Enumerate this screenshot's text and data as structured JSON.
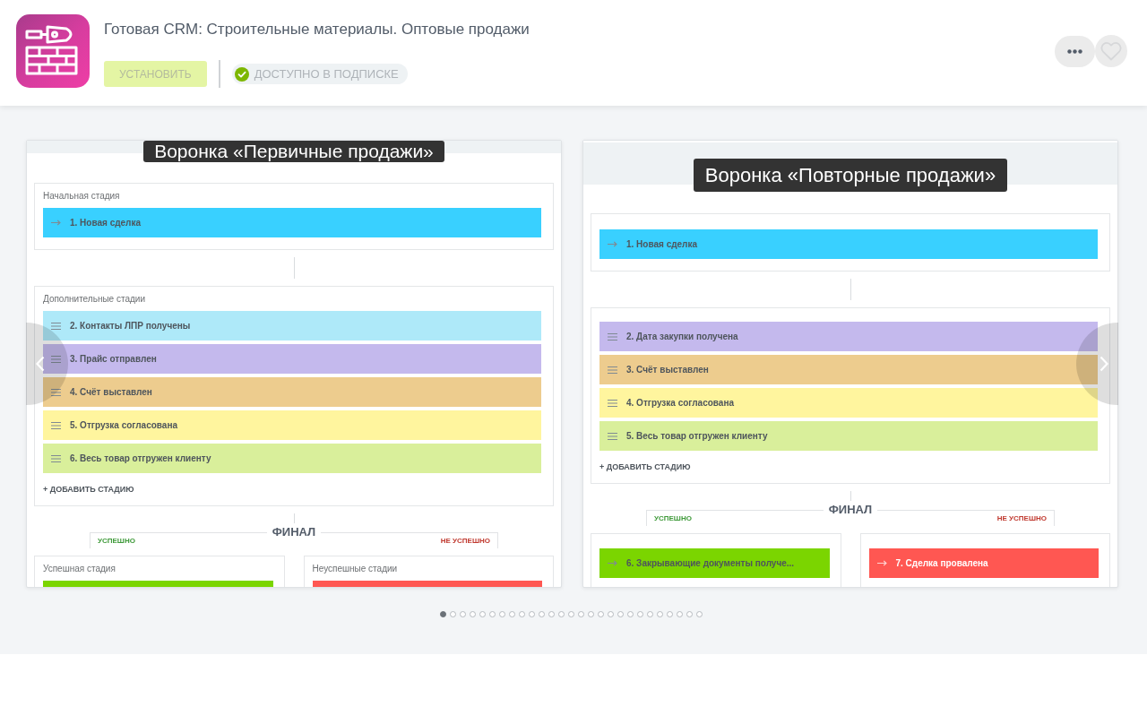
{
  "header": {
    "title": "Готовая CRM: Строительные материалы. Оптовые продажи",
    "install_button": {
      "label": "УСТАНОВИТЬ",
      "disabled": true
    },
    "subscription_badge": "ДОСТУПНО В ПОДПИСКЕ"
  },
  "slides": [
    {
      "title": "Воронка «Первичные продажи»",
      "start": {
        "label": "Начальная стадия",
        "stages": [
          {
            "kind": "fixed",
            "name": "1. Новая сделка",
            "color": "#39d0ff"
          }
        ]
      },
      "extra": {
        "label": "Дополнительные стадии",
        "stages": [
          {
            "kind": "sortable",
            "name": "2. Контакты ЛПР получены",
            "color": "#aee9f9"
          },
          {
            "kind": "sortable",
            "name": "3. Прайс отправлен",
            "color": "#c4b9ed"
          },
          {
            "kind": "sortable",
            "name": "4. Счёт выставлен",
            "color": "#edcc8e"
          },
          {
            "kind": "sortable",
            "name": "5. Отгрузка согласована",
            "color": "#fff59e"
          },
          {
            "kind": "sortable",
            "name": "6. Весь товар отгружен клиенту",
            "color": "#d9ef9b"
          }
        ],
        "add_link": "+ ДОБАВИТЬ СТАДИЮ"
      },
      "final": {
        "title": "ФИНАЛ",
        "success_label": "УСПЕШНО",
        "failure_label": "НЕ УСПЕШНО",
        "success": {
          "label": "Успешная стадия",
          "stages": [
            {
              "color": "#7bd500"
            }
          ]
        },
        "failure": {
          "label": "Неуспешные стадии",
          "stages": [
            {
              "color": "#ff5752"
            }
          ]
        }
      }
    },
    {
      "title": "Воронка «Повторные продажи»",
      "start": {
        "stages": [
          {
            "kind": "fixed",
            "name": "1. Новая сделка",
            "color": "#39d0ff"
          }
        ]
      },
      "extra": {
        "stages": [
          {
            "kind": "sortable",
            "name": "2. Дата закупки получена",
            "color": "#c4b9ed"
          },
          {
            "kind": "sortable",
            "name": "3. Счёт выставлен",
            "color": "#edcc8e"
          },
          {
            "kind": "sortable",
            "name": "4. Отгрузка согласована",
            "color": "#fff59e"
          },
          {
            "kind": "sortable",
            "name": "5. Весь товар отгружен клиенту",
            "color": "#d9ef9b"
          }
        ],
        "add_link": "+ ДОБАВИТЬ СТАДИЮ"
      },
      "final": {
        "title": "ФИНАЛ",
        "success_label": "УСПЕШНО",
        "failure_label": "НЕ УСПЕШНО",
        "success": {
          "stages": [
            {
              "kind": "fixed",
              "name": "6. Закрывающие документы получе...",
              "color": "#7bd500"
            }
          ]
        },
        "failure": {
          "stages": [
            {
              "kind": "fixed",
              "name": "7. Сделка провалена",
              "color": "#ff5752"
            }
          ]
        }
      }
    }
  ],
  "carousel": {
    "pages": [
      {
        "selected": true
      },
      {
        "selected": false
      },
      {
        "selected": false
      },
      {
        "selected": false
      },
      {
        "selected": false
      },
      {
        "selected": false
      },
      {
        "selected": false
      },
      {
        "selected": false
      },
      {
        "selected": false
      },
      {
        "selected": false
      },
      {
        "selected": false
      },
      {
        "selected": false
      },
      {
        "selected": false
      },
      {
        "selected": false
      },
      {
        "selected": false
      },
      {
        "selected": false
      },
      {
        "selected": false
      },
      {
        "selected": false
      },
      {
        "selected": false
      },
      {
        "selected": false
      },
      {
        "selected": false
      },
      {
        "selected": false
      },
      {
        "selected": false
      },
      {
        "selected": false
      },
      {
        "selected": false
      },
      {
        "selected": false
      },
      {
        "selected": false
      }
    ]
  }
}
